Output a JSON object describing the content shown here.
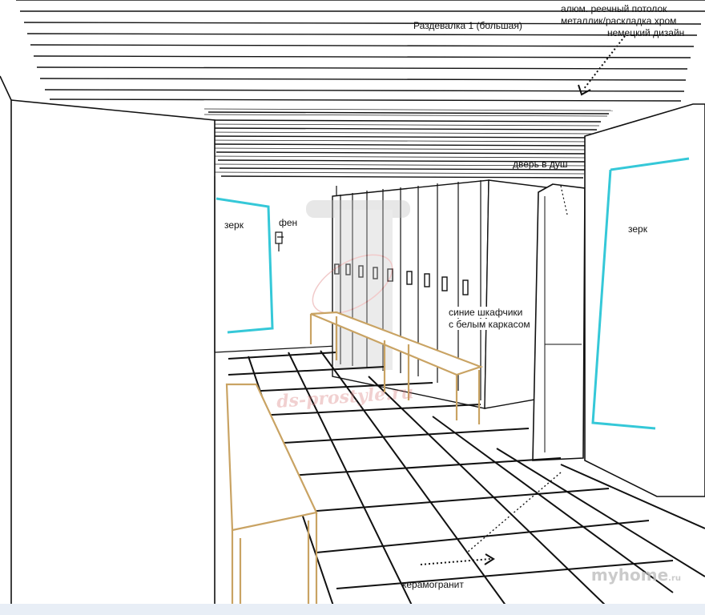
{
  "title": "Раздевалка 1 (большая)",
  "annotations": {
    "ceiling_line1": "алюм. реечный потолок",
    "ceiling_line2": "металлик/раскладка хром",
    "ceiling_line3": "немецкий дизайн",
    "shower_door": "дверь в душ",
    "mirror_left": "зерк",
    "hairdryer": "фен",
    "mirror_right": "зерк",
    "lockers_line1": "синие шкафчики",
    "lockers_line2": "с белым каркасом",
    "floor": "керамогранит"
  },
  "watermark": {
    "text": "ds-prostyle.ru"
  },
  "credit": {
    "main": "myhome",
    "suffix": ".ru"
  },
  "colors": {
    "mirror": "#35c8d8",
    "bench_wood": "#d7b27a",
    "line": "#111111"
  }
}
